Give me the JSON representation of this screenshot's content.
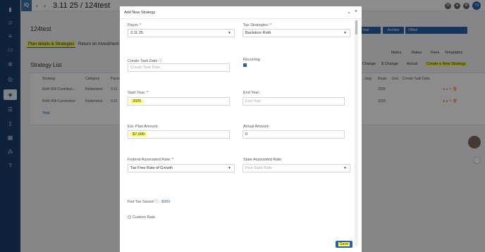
{
  "app": {
    "logo": "iQ"
  },
  "topbar": {
    "title": "3.11 25 / 124test",
    "back": "‹",
    "forward": "›",
    "user_initials": "TS"
  },
  "page": {
    "record_title": "124test",
    "tabs": [
      "Plan details & Strategies",
      "Return on Investment"
    ],
    "section_title": "Strategy List",
    "buttons": {
      "year": "...nce Year",
      "archive": "Archive",
      "offset": "Offset"
    },
    "links": [
      "Notes",
      "Rates",
      "Fees",
      "Templates"
    ],
    "filters": {
      "change": "Change",
      "s_change": "$ Change",
      "actual": "Actual",
      "create": "Create a New Strategy"
    },
    "table_headers": [
      "Strategy",
      "Category",
      "Payor"
    ],
    "table_headers_right": [
      "...tegy",
      "Begin",
      "End",
      "Create Task Date"
    ],
    "rows": [
      {
        "strategy": "Roth IRA Contributi...",
        "category": "Retirement",
        "payor": "3.11",
        "begin": "2025"
      },
      {
        "strategy": "Roth IRA Conversion",
        "category": "Retirement",
        "payor": "3.11",
        "begin": "2025"
      }
    ],
    "total_label": "Total"
  },
  "modal": {
    "title": "Add New Strategy",
    "payor_label": "Payor: *",
    "payor_value": "3.11 25",
    "tax_strategies_label": "Tax Strategies: *",
    "tax_strategies_value": "Backdoor Roth",
    "create_task_date_label": "Create Task Date",
    "create_task_date_placeholder": "Create Task Date",
    "recurring_label": "Recurring",
    "start_year_label": "Start Year: *",
    "start_year_value": "2025",
    "end_year_label": "End Year:",
    "end_year_placeholder": "End Year",
    "est_plan_amount_label": "Est. Plan Amount:",
    "est_plan_amount_value": "$7,000",
    "actual_amount_label": "Actual Amount:",
    "actual_amount_value": "0",
    "federal_rate_label": "Federal Associated Rate: *",
    "federal_rate_value": "Tax Free Rate of Growth",
    "state_rate_label": "State Associated Rate:",
    "state_rate_placeholder": "Pick State Rate",
    "fed_tax_saved_label": "Fed Tax Saved",
    "fed_tax_saved_value": "$350",
    "custom_rate_label": "Custom Rate",
    "save_label": "Save"
  },
  "colors": {
    "primary": "#2b5fa8",
    "sidebar": "#1c3f6e",
    "highlight": "#ffff59"
  }
}
